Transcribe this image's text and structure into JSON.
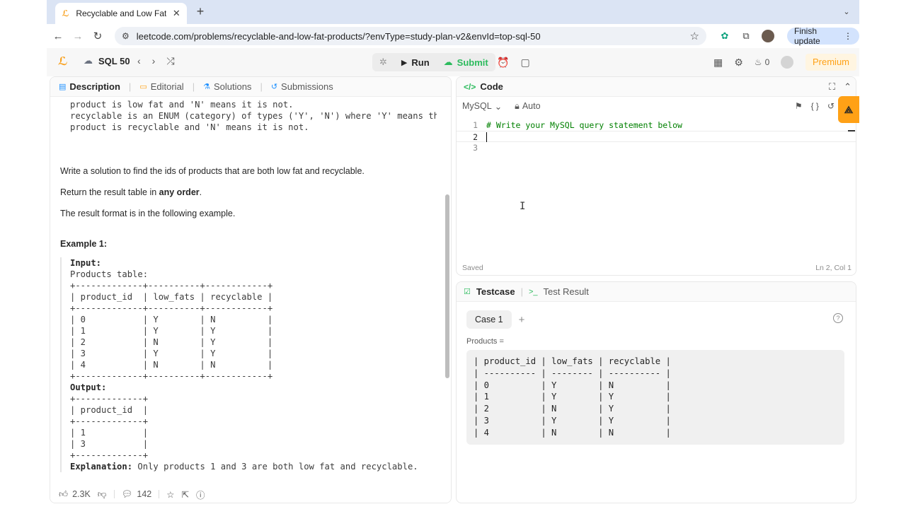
{
  "browser": {
    "tab_title": "Recyclable and Low Fat Prod",
    "tab_close": "✕",
    "new_tab": "+",
    "tab_menu": "⌄",
    "url": "leetcode.com/problems/recyclable-and-low-fat-products/?envType=study-plan-v2&envId=top-sql-50",
    "finish_update": "Finish update",
    "menu_dots": "⋮"
  },
  "lc_nav": {
    "study_plan": "SQL 50",
    "run_label": "Run",
    "submit_label": "Submit",
    "streak_count": "0",
    "premium_label": "Premium"
  },
  "left_tabs": {
    "description": "Description",
    "editorial": "Editorial",
    "solutions": "Solutions",
    "submissions": "Submissions"
  },
  "description": {
    "schema_lines": "product is low fat and 'N' means it is not.\nrecyclable is an ENUM (category) of types ('Y', 'N') where 'Y' means this\nproduct is recyclable and 'N' means it is not.",
    "para1": "Write a solution to find the ids of products that are both low fat and recyclable.",
    "para2_prefix": "Return the result table in ",
    "para2_bold": "any order",
    "para2_suffix": ".",
    "para3": "The result format is in the following example.",
    "example_title": "Example 1:",
    "input_label": "Input:",
    "input_body": "Products table:\n+-------------+----------+------------+\n| product_id  | low_fats | recyclable |\n+-------------+----------+------------+\n| 0           | Y        | N          |\n| 1           | Y        | Y          |\n| 2           | N        | Y          |\n| 3           | Y        | Y          |\n| 4           | N        | N          |\n+-------------+----------+------------+",
    "output_label": "Output:",
    "output_body": "+-------------+\n| product_id  |\n+-------------+\n| 1           |\n| 3           |\n+-------------+",
    "explanation_label": "Explanation:",
    "explanation_text": " Only products 1 and 3 are both low fat and recyclable."
  },
  "left_footer": {
    "likes": "2.3K",
    "comments": "142"
  },
  "code": {
    "title": "Code",
    "language": "MySQL",
    "mode": "Auto",
    "lines": [
      {
        "num": "1",
        "text": "# Write your MySQL query statement below"
      },
      {
        "num": "2",
        "text": ""
      },
      {
        "num": "3",
        "text": ""
      }
    ],
    "status_saved": "Saved",
    "cursor_pos": "Ln 2, Col 1"
  },
  "testcase": {
    "tab_testcase": "Testcase",
    "tab_result": "Test Result",
    "case_label": "Case 1",
    "add_case": "+",
    "var_label": "Products =",
    "var_value": "| product_id | low_fats | recyclable |\n| ---------- | -------- | ---------- |\n| 0          | Y        | N          |\n| 1          | Y        | Y          |\n| 2          | N        | Y          |\n| 3          | Y        | Y          |\n| 4          | N        | N          |"
  },
  "colors": {
    "accent_orange": "#ffa116",
    "accent_green": "#2cbb5d",
    "tab_strip": "#dbe4f4"
  }
}
